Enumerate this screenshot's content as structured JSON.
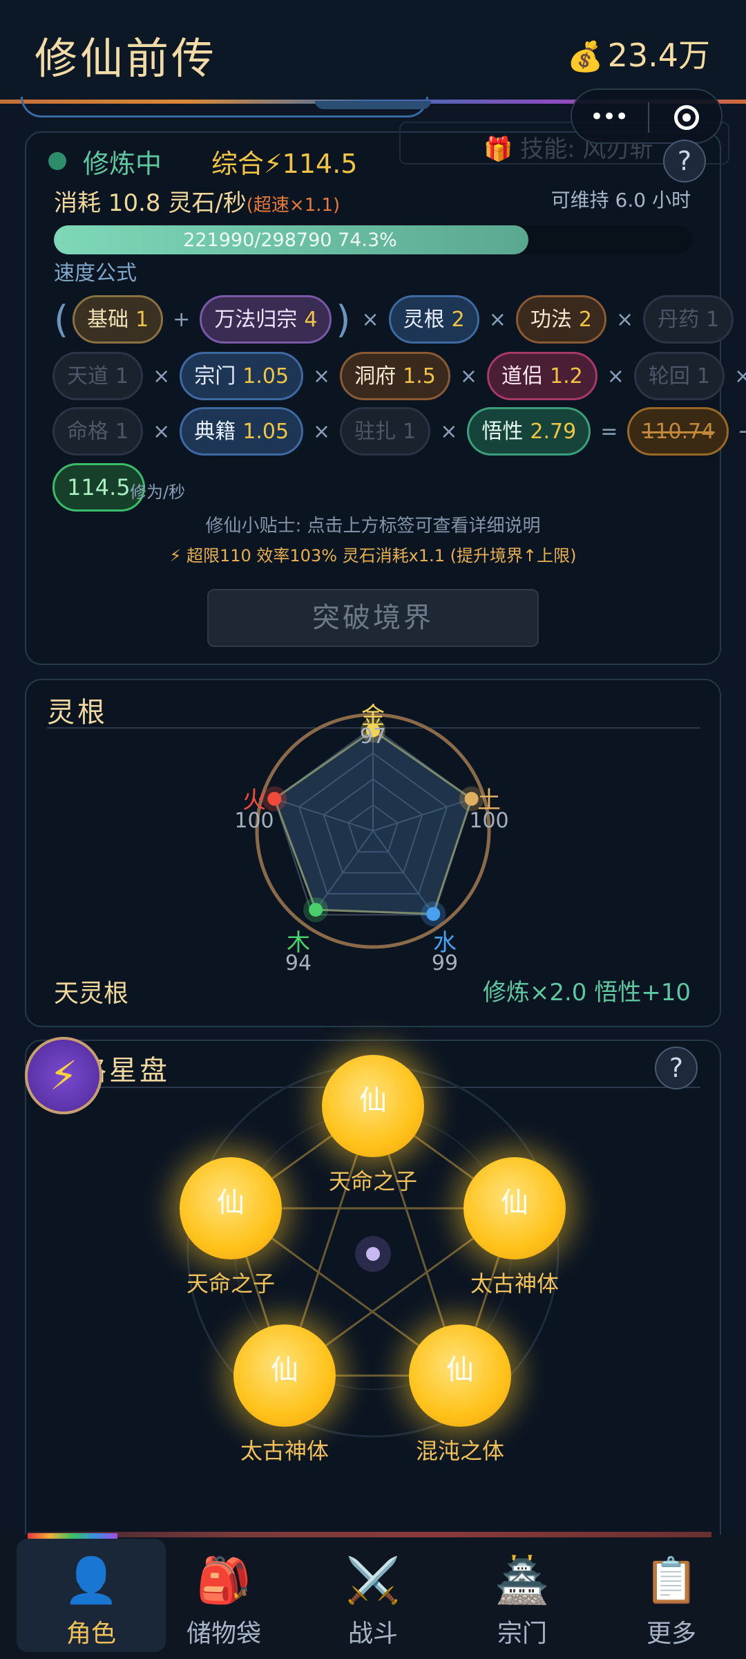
{
  "header": {
    "title": "修仙前传",
    "money_icon": "money-bag-icon",
    "money": "23.4万"
  },
  "capsule": {
    "more": "•••"
  },
  "ghost_skill": "🎁 技能: 风刃斩",
  "cultivation": {
    "status": "修炼中",
    "power_label": "综合⚡114.5",
    "consume_label": "消耗 10.8 灵石/秒",
    "boost_label": "(超速×1.1)",
    "sustain": "可维持 6.0 小时",
    "progress_text": "221990/298790  74.3%",
    "progress_fraction": 0.743,
    "formula_label": "速度公式",
    "chips": {
      "basic": {
        "label": "基础",
        "value": "1"
      },
      "wanfa": {
        "label": "万法归宗",
        "value": "4"
      },
      "root": {
        "label": "灵根",
        "value": "2"
      },
      "skill": {
        "label": "功法",
        "value": "2"
      },
      "pill": {
        "label": "丹药",
        "value": "1"
      },
      "heaven": {
        "label": "天道",
        "value": "1"
      },
      "sect": {
        "label": "宗门",
        "value": "1.05"
      },
      "cave": {
        "label": "洞府",
        "value": "1.5"
      },
      "partner": {
        "label": "道侣",
        "value": "1.2"
      },
      "reincarnation": {
        "label": "轮回",
        "value": "1"
      },
      "fate": {
        "label": "命格",
        "value": "1"
      },
      "books": {
        "label": "典籍",
        "value": "1.05"
      },
      "station": {
        "label": "驻扎",
        "value": "1"
      },
      "insight": {
        "label": "悟性",
        "value": "2.79"
      },
      "raw": "110.74"
    },
    "ops": {
      "open": "(",
      "close": ")",
      "plus": "+",
      "times": "×",
      "eq": "=",
      "arrow": "→"
    },
    "result": "114.5",
    "result_unit": "修为/秒",
    "tip": "修仙小贴士: 点击上方标签可查看详细说明",
    "limit_tip": "⚡ 超限110 效率103% 灵石消耗x1.1 (提升境界↑上限)",
    "breakthrough": "突破境界"
  },
  "spirit_root": {
    "title": "灵根",
    "elements": [
      {
        "name": "金",
        "value": "97",
        "color": "#f2d45a"
      },
      {
        "name": "土",
        "value": "100",
        "color": "#e0b060"
      },
      {
        "name": "水",
        "value": "99",
        "color": "#4aa0f0"
      },
      {
        "name": "木",
        "value": "94",
        "color": "#4ad06a"
      },
      {
        "name": "火",
        "value": "100",
        "color": "#f04a3a"
      }
    ],
    "root_name": "天灵根",
    "bonus": "修炼×2.0  悟性+10"
  },
  "star_chart": {
    "title": "命格星盘",
    "help": "?",
    "zap": "⚡",
    "nodes": [
      {
        "glyph": "仙",
        "label": "天命之子"
      },
      {
        "glyph": "仙",
        "label": "天命之子"
      },
      {
        "glyph": "仙",
        "label": "太古神体"
      },
      {
        "glyph": "仙",
        "label": "太古神体"
      },
      {
        "glyph": "仙",
        "label": "混沌之体"
      }
    ]
  },
  "help_symbol": "?",
  "nav": [
    {
      "label": "角色",
      "icon": "👤"
    },
    {
      "label": "储物袋",
      "icon": "🎒"
    },
    {
      "label": "战斗",
      "icon": "⚔️"
    },
    {
      "label": "宗门",
      "icon": "🏯"
    },
    {
      "label": "更多",
      "icon": "📋"
    }
  ],
  "colors": {
    "accent_gold": "#f2c444",
    "accent_green": "#5ec8a0",
    "background": "#0c1624"
  }
}
